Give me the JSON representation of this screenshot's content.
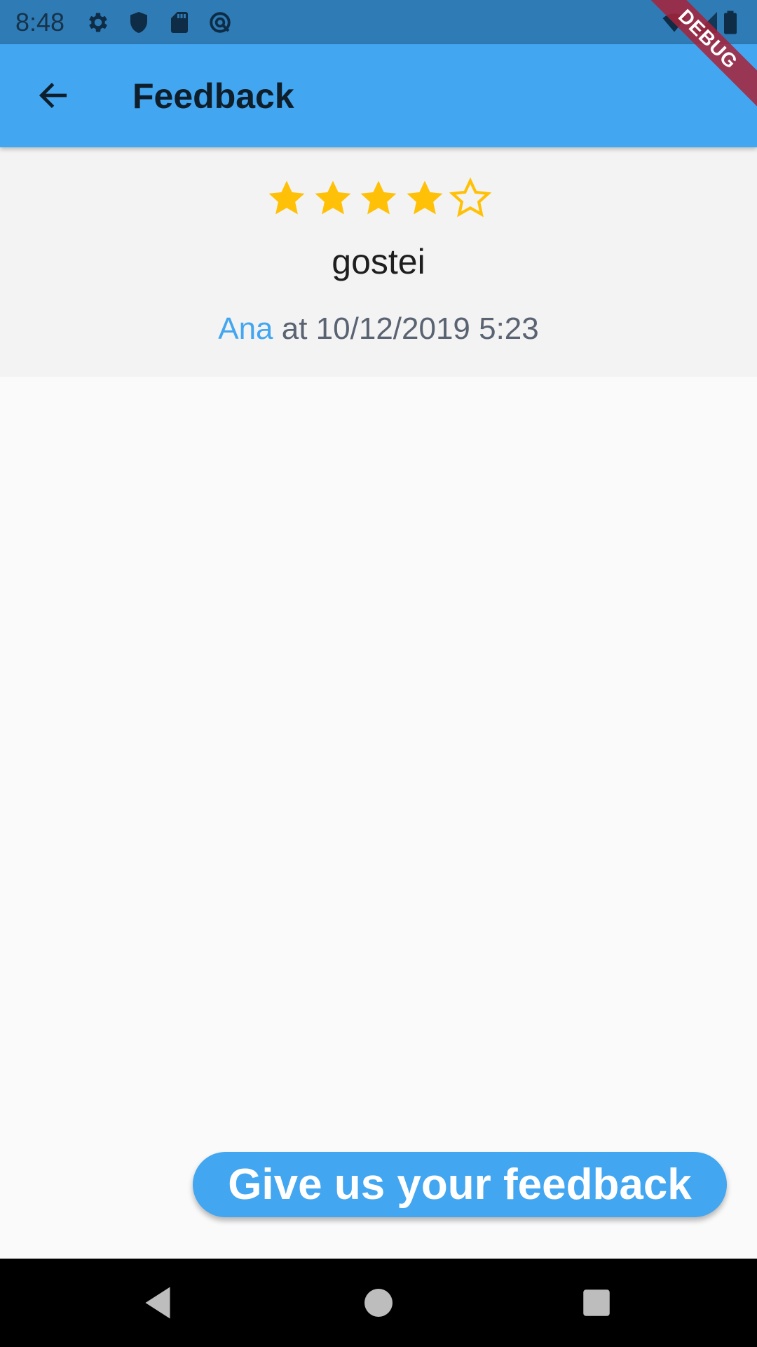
{
  "status_bar": {
    "time": "8:48",
    "icons": [
      "settings-icon",
      "shield-icon",
      "sd-card-icon",
      "data-saver-icon",
      "wifi-icon",
      "signal-icon",
      "battery-icon"
    ]
  },
  "app_bar": {
    "title": "Feedback",
    "back_icon": "arrow-back-icon"
  },
  "debug_banner": {
    "label": "DEBUG"
  },
  "feedback": {
    "rating": 4,
    "max_rating": 5,
    "comment": "gostei",
    "author": "Ana",
    "meta": " at 10/12/2019 5:23"
  },
  "fab": {
    "label": "Give us your feedback"
  },
  "nav_bar": {
    "icons": [
      "nav-back-icon",
      "nav-home-icon",
      "nav-recents-icon"
    ]
  },
  "colors": {
    "status_bar": "#2f7bb5",
    "app_bar": "#42a6f0",
    "star": "#ffc107",
    "author_link": "#42a6f0",
    "fab": "#42a6f0",
    "debug_banner": "#a82238"
  }
}
